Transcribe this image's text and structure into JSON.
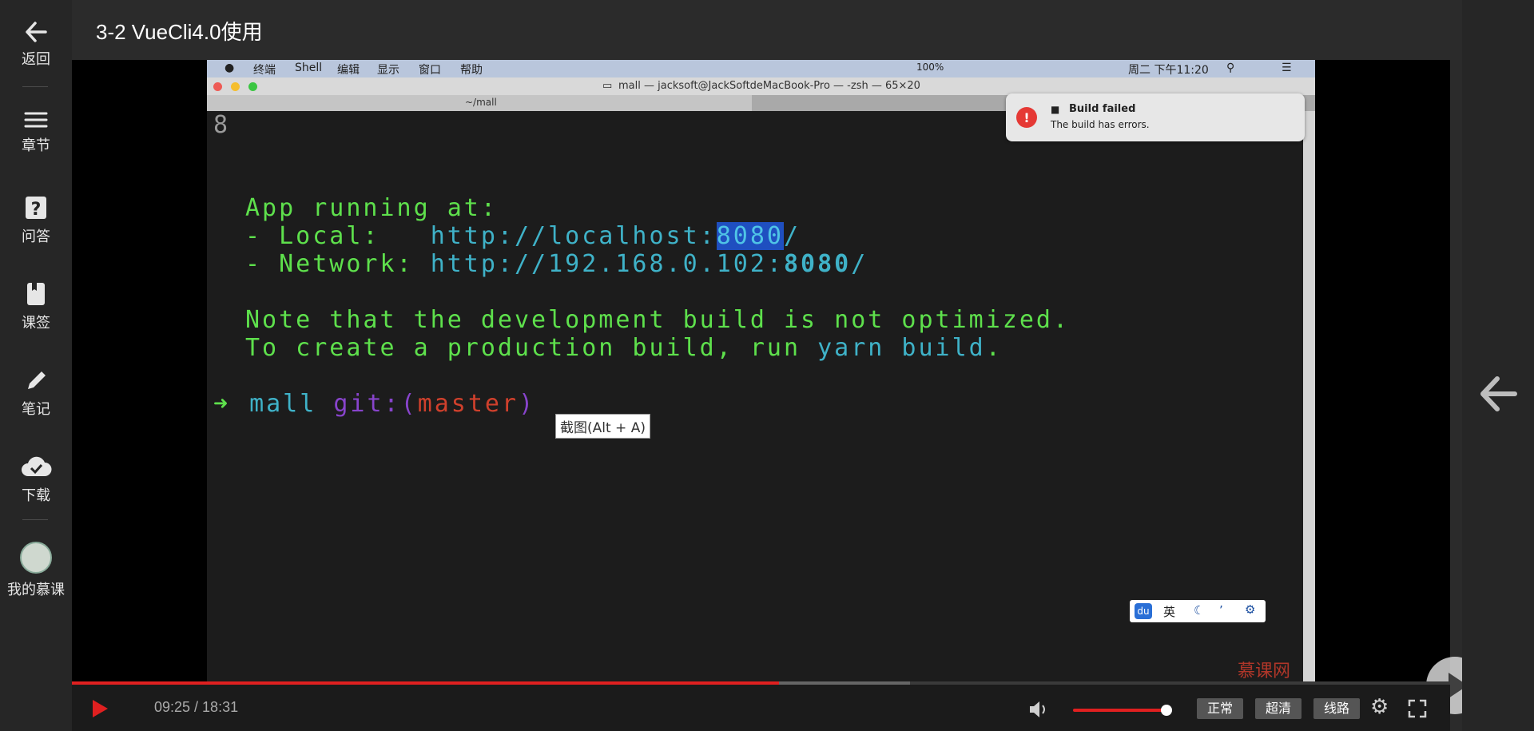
{
  "nav": {
    "back": "返回",
    "chapters": "章节",
    "qa": "问答",
    "bookmarks": "课签",
    "notes": "笔记",
    "download": "下载",
    "my_courses": "我的慕课"
  },
  "title": "3-2 VueCli4.0使用",
  "mac": {
    "menu": [
      "终端",
      "Shell",
      "编辑",
      "显示",
      "窗口",
      "帮助"
    ],
    "battery": "100%",
    "clock": "周二 下午11:20",
    "window_title": "mall — jacksoft@JackSoftdeMacBook-Pro — -zsh — 65×20",
    "tab_title": "~/mall",
    "notification": {
      "title": "Build failed",
      "body": "The build has errors."
    }
  },
  "terminal": {
    "line0": "8",
    "app_running": "App running at:",
    "local_label": "- Local:   ",
    "local_url": "http://localhost:",
    "local_port": "8080",
    "local_tail": "/",
    "network_label": "- Network: ",
    "network_url": "http://192.168.0.102:",
    "network_port": "8080",
    "network_tail": "/",
    "note1": "Note that the development build is not optimized.",
    "note2_a": "To create a production build, run ",
    "note2_b": "yarn build",
    "note2_c": ".",
    "prompt_dir": "mall",
    "prompt_git": "git:(",
    "prompt_branch": "master",
    "prompt_close": ")"
  },
  "tooltip": "截图(Alt + A)",
  "ime": {
    "lang": "英"
  },
  "watermark": "慕课网",
  "player": {
    "time": "09:25 / 18:31",
    "progress": 0.513,
    "buffered": 0.608,
    "volume": 0.9,
    "quality_normal": "正常",
    "quality_hd": "超清",
    "route": "线路"
  },
  "colors": {
    "accent": "#e02020",
    "terminal_green": "#5ee04c",
    "terminal_cyan": "#3fb2c8"
  }
}
